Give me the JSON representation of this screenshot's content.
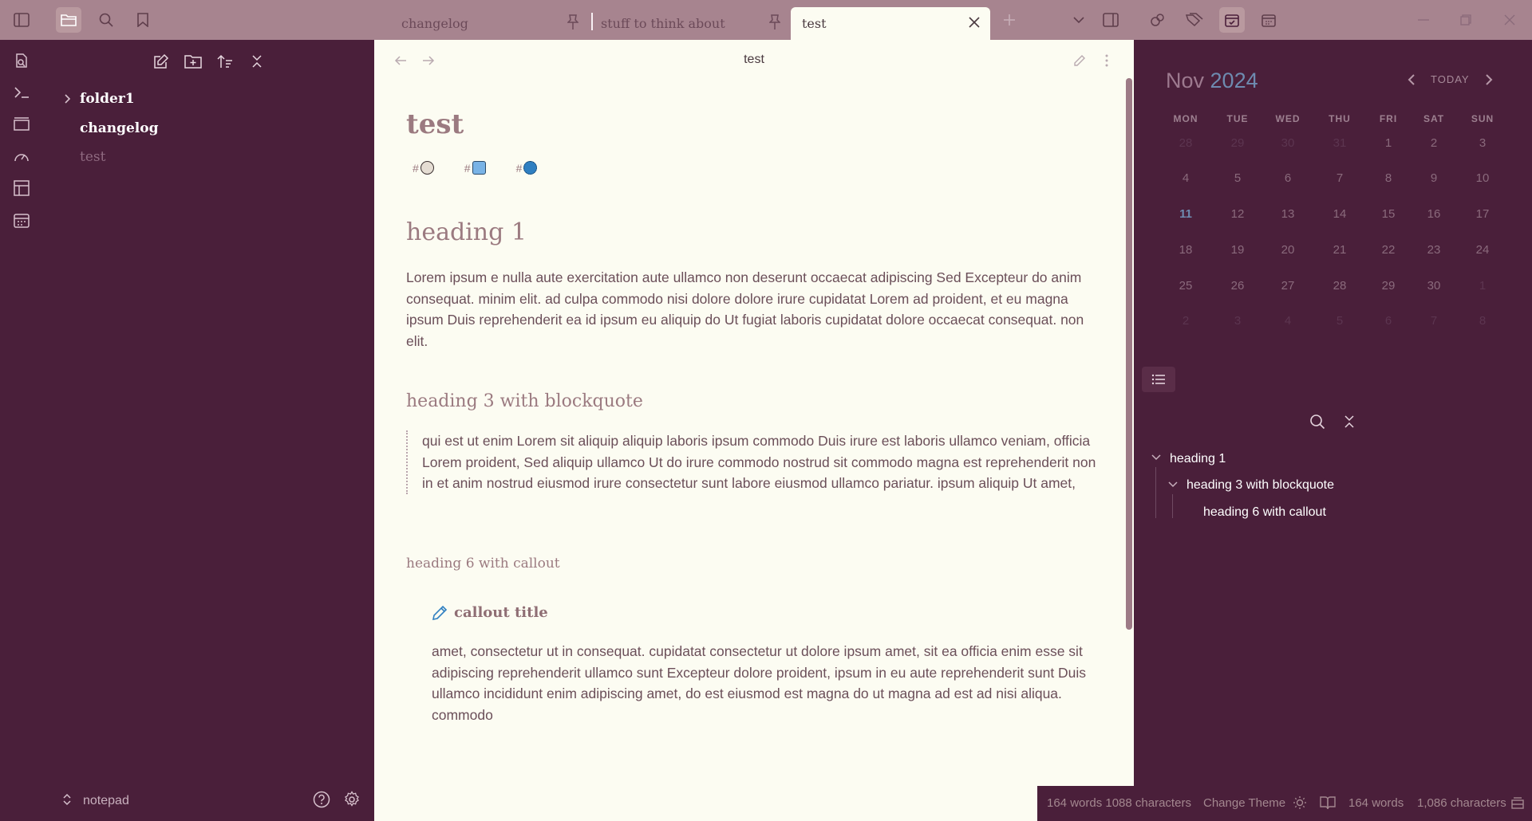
{
  "tabs": [
    {
      "label": "changelog",
      "pinned": true,
      "active": false
    },
    {
      "label": "stuff to think about",
      "pinned": true,
      "active": false
    },
    {
      "label": "test",
      "pinned": false,
      "active": true
    }
  ],
  "sidebar": {
    "files": [
      {
        "label": "folder1",
        "type": "folder"
      },
      {
        "label": "changelog",
        "type": "file"
      },
      {
        "label": "test",
        "type": "file",
        "active": true
      }
    ],
    "vault_name": "notepad"
  },
  "editor": {
    "view_title": "test",
    "title": "test",
    "tags": [
      {
        "hash": "#",
        "emoji": "mushroom",
        "color": "#d9d0c6"
      },
      {
        "hash": "#",
        "emoji": "blue-cube",
        "color": "#79b3e6"
      },
      {
        "hash": "#",
        "emoji": "blue-flower",
        "color": "#2f7fc1"
      }
    ],
    "heading1": "heading 1",
    "paragraph1": "Lorem ipsum e nulla aute exercitation aute ullamco non deserunt occaecat adipiscing Sed Excepteur do anim consequat. minim elit. ad culpa commodo nisi dolore dolore irure cupidatat Lorem ad proident, et eu magna ipsum Duis reprehenderit ea id ipsum eu aliquip do Ut fugiat laboris cupidatat dolore occaecat consequat. non elit.",
    "heading3": "heading 3 with blockquote",
    "blockquote": "qui est ut enim Lorem sit aliquip aliquip laboris ipsum commodo Duis irure est laboris ullamco veniam, officia Lorem proident, Sed aliquip ullamco Ut do irure commodo nostrud sit commodo magna est reprehenderit non in et anim nostrud eiusmod irure consectetur sunt labore eiusmod ullamco pariatur. ipsum aliquip Ut amet,",
    "heading6": "heading 6 with callout",
    "callout_title": "callout title",
    "callout_body": "amet, consectetur ut in consequat. cupidatat consectetur ut dolore ipsum amet, sit ea officia enim esse sit adipiscing reprehenderit ullamco sunt Excepteur dolore proident, ipsum in eu aute reprehenderit sunt Duis ullamco incididunt enim adipiscing amet, do est eiusmod est magna do ut magna ad est ad nisi aliqua. commodo"
  },
  "calendar": {
    "month": "Nov",
    "year": "2024",
    "today_label": "TODAY",
    "weekdays": [
      "MON",
      "TUE",
      "WED",
      "THU",
      "FRI",
      "SAT",
      "SUN"
    ],
    "weeks": [
      [
        "28",
        "29",
        "30",
        "31",
        "1",
        "2",
        "3"
      ],
      [
        "4",
        "5",
        "6",
        "7",
        "8",
        "9",
        "10"
      ],
      [
        "11",
        "12",
        "13",
        "14",
        "15",
        "16",
        "17"
      ],
      [
        "18",
        "19",
        "20",
        "21",
        "22",
        "23",
        "24"
      ],
      [
        "25",
        "26",
        "27",
        "28",
        "29",
        "30",
        "1"
      ],
      [
        "2",
        "3",
        "4",
        "5",
        "6",
        "7",
        "8"
      ]
    ],
    "today": "11"
  },
  "outline": {
    "items": [
      {
        "label": "heading 1",
        "level": 1
      },
      {
        "label": "heading 3 with blockquote",
        "level": 2
      },
      {
        "label": "heading 6 with callout",
        "level": 3
      }
    ]
  },
  "status": {
    "words_chars_1": "164 words 1088 characters",
    "change_theme": "Change Theme",
    "words": "164 words",
    "chars": "1,086 characters"
  }
}
